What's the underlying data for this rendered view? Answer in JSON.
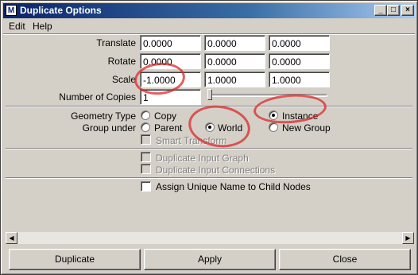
{
  "window": {
    "title": "Duplicate Options",
    "app_icon_glyph": "M"
  },
  "titlebar_buttons": {
    "minimize": "_",
    "maximize": "□",
    "close": "×"
  },
  "menu": [
    "Edit",
    "Help"
  ],
  "transform": {
    "translate": {
      "label": "Translate",
      "values": [
        "0.0000",
        "0.0000",
        "0.0000"
      ]
    },
    "rotate": {
      "label": "Rotate",
      "values": [
        "0.0000",
        "0.0000",
        "0.0000"
      ]
    },
    "scale": {
      "label": "Scale",
      "values": [
        "-1.0000",
        "1.0000",
        "1.0000"
      ]
    },
    "copies": {
      "label": "Number of Copies",
      "value": "1"
    }
  },
  "geometry_type": {
    "label": "Geometry Type",
    "options": [
      "Copy",
      "Instance"
    ],
    "selected": "Instance"
  },
  "group_under": {
    "label": "Group under",
    "options": [
      "Parent",
      "World",
      "New Group"
    ],
    "selected": "World"
  },
  "checkboxes": {
    "smart_transform": "Smart Transform",
    "dup_input_graph": "Duplicate Input Graph",
    "dup_input_connections": "Duplicate Input Connections",
    "assign_unique_name": "Assign Unique Name to Child Nodes"
  },
  "scroll_arrows": {
    "left": "◀",
    "right": "▶"
  },
  "buttons": {
    "duplicate": "Duplicate",
    "apply": "Apply",
    "close": "Close"
  },
  "annotation_color": "#dc2828"
}
